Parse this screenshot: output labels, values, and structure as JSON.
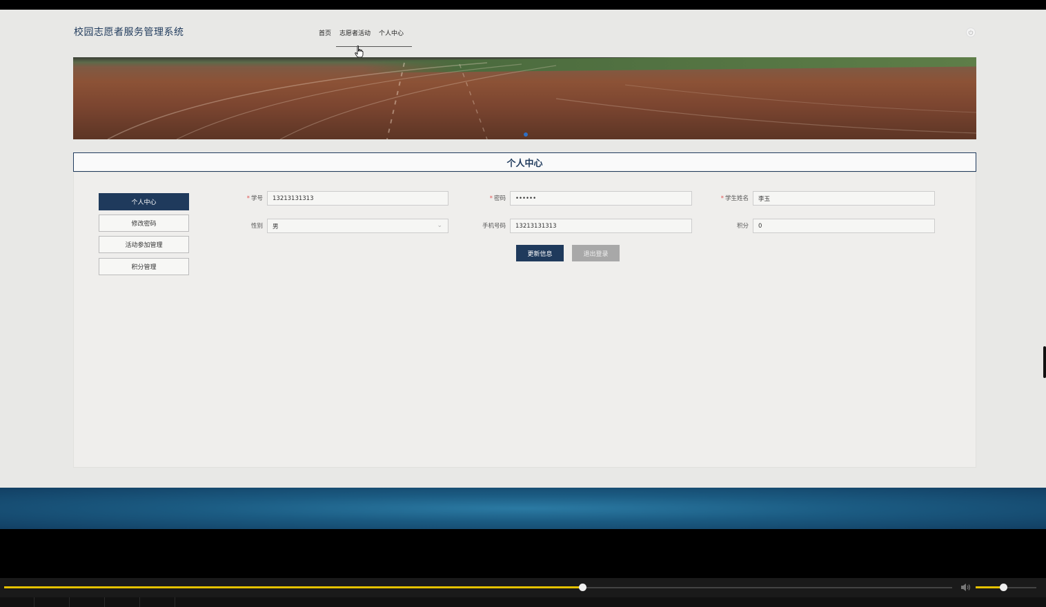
{
  "site": {
    "title": "校园志愿者服务管理系统"
  },
  "nav": {
    "items": [
      "首页",
      "志愿者活动",
      "个人中心"
    ]
  },
  "section": {
    "title": "个人中心"
  },
  "sidebar": {
    "items": [
      "个人中心",
      "修改密码",
      "活动参加管理",
      "积分管理"
    ],
    "active_index": 0
  },
  "form": {
    "student_id": {
      "label": "学号",
      "required": true,
      "value": "13213131313"
    },
    "password": {
      "label": "密码",
      "required": true,
      "value": "••••••"
    },
    "student_name": {
      "label": "学生姓名",
      "required": true,
      "value": "李玉"
    },
    "gender": {
      "label": "性别",
      "required": false,
      "value": "男"
    },
    "phone": {
      "label": "手机号码",
      "required": false,
      "value": "13213131313"
    },
    "points": {
      "label": "积分",
      "required": false,
      "value": "0"
    }
  },
  "buttons": {
    "update": "更新信息",
    "logout": "退出登录"
  },
  "player": {
    "progress": 0.61,
    "volume": 0.45
  },
  "colors": {
    "accent": "#1f3a5c",
    "player_accent": "#e6c200",
    "footer": "#1b5b82"
  },
  "icons": {
    "power": "power-icon",
    "cursor": "hand-cursor-icon",
    "speaker": "speaker-icon",
    "chevron": "chevron-down-icon"
  }
}
